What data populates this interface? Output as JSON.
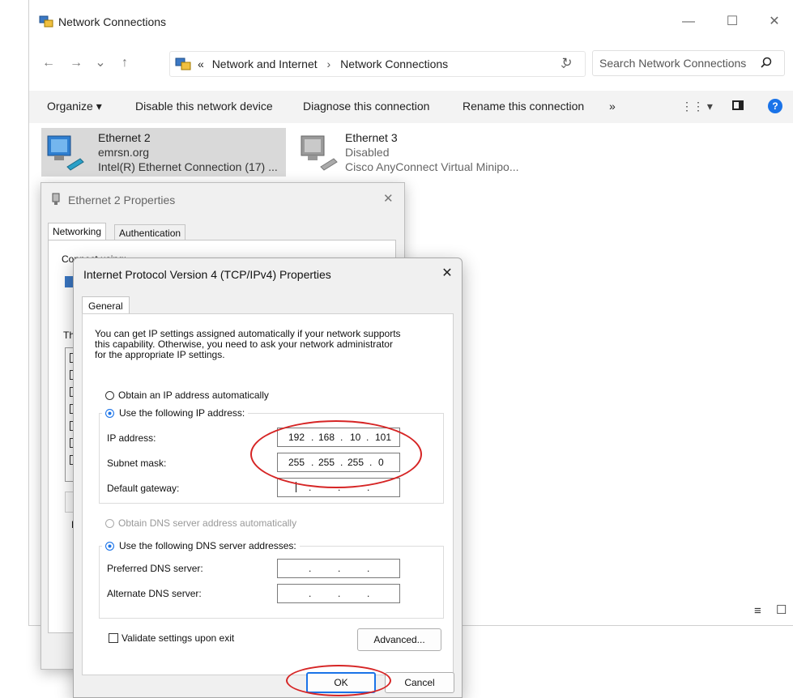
{
  "explorer": {
    "title": "Network Connections",
    "nav": {
      "back": "←",
      "forward": "→",
      "recent": "⌄",
      "up": "↑"
    },
    "breadcrumb": {
      "chevron": "«",
      "part1": "Network and Internet",
      "sep": "›",
      "part2": "Network Connections",
      "dropdown": "⌄"
    },
    "refresh": "↻",
    "search_placeholder": "Search Network Connections",
    "window": {
      "minimize": "—",
      "maximize": "☐",
      "close": "✕"
    },
    "commands": {
      "organize": "Organize ▾",
      "disable": "Disable this network device",
      "diagnose": "Diagnose this connection",
      "rename": "Rename this connection",
      "more": "»",
      "view": "⋮⋮ ▾"
    },
    "items": [
      {
        "name": "Ethernet 2",
        "status": "emrsn.org",
        "device": "Intel(R) Ethernet Connection (17) ..."
      },
      {
        "name": "Ethernet 3",
        "status": "Disabled",
        "device": "Cisco AnyConnect Virtual Minipo..."
      }
    ],
    "status_icons": {
      "details": "≡",
      "tiles": "☐"
    }
  },
  "eth_dialog": {
    "title": "Ethernet 2 Properties",
    "close": "✕",
    "tabs": [
      "Networking",
      "Authentication"
    ],
    "connect_using_partial": "Connect using:",
    "this_partial": "Th",
    "d_partial": "D"
  },
  "ipv4": {
    "title": "Internet Protocol Version 4 (TCP/IPv4) Properties",
    "close": "✕",
    "tab": "General",
    "intro": [
      "You can get IP settings assigned automatically if your network supports",
      "this capability. Otherwise, you need to ask your network administrator",
      "for the appropriate IP settings."
    ],
    "radio_auto_ip": "Obtain an IP address automatically",
    "radio_manual_ip": "Use the following IP address:",
    "ip_label": "IP address:",
    "ip_value": [
      "192",
      "168",
      "10",
      "101"
    ],
    "mask_label": "Subnet mask:",
    "mask_value": [
      "255",
      "255",
      "255",
      "0"
    ],
    "gateway_label": "Default gateway:",
    "gateway_value": [
      "",
      "",
      "",
      ""
    ],
    "dot": ".",
    "radio_auto_dns": "Obtain DNS server address automatically",
    "radio_manual_dns": "Use the following DNS server addresses:",
    "pref_dns_label": "Preferred DNS server:",
    "alt_dns_label": "Alternate DNS server:",
    "validate_label": "Validate settings upon exit",
    "advanced": "Advanced...",
    "ok": "OK",
    "cancel": "Cancel"
  },
  "colors": {
    "annotation": "#d62525",
    "accent": "#1a73e8"
  }
}
